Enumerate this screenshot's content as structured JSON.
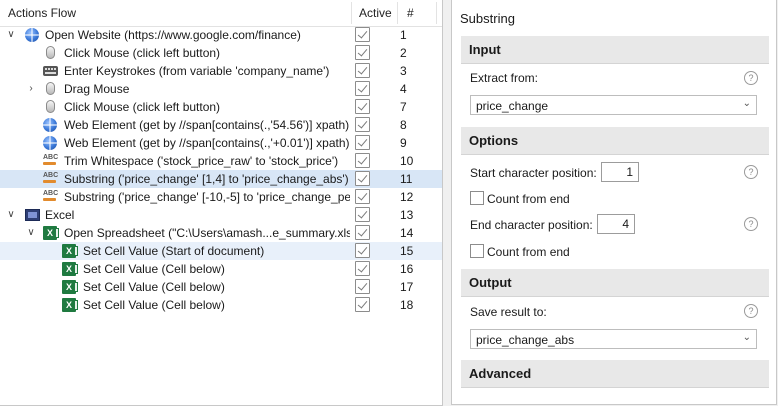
{
  "left_panel": {
    "col_actions": "Actions Flow",
    "col_active": "Active",
    "col_num": "#",
    "rows": [
      {
        "label": "Open Website (https://www.google.com/finance)",
        "num": "1"
      },
      {
        "label": "Click Mouse (click left button)",
        "num": "2"
      },
      {
        "label": "Enter Keystrokes (from variable 'company_name')",
        "num": "3"
      },
      {
        "label": "Drag Mouse",
        "num": "4"
      },
      {
        "label": "Click Mouse (click left button)",
        "num": "7"
      },
      {
        "label": "Web Element (get by //span[contains(.,'54.56')] xpath)",
        "num": "8"
      },
      {
        "label": "Web Element (get by //span[contains(.,'+0.01')] xpath)",
        "num": "9"
      },
      {
        "label": "Trim Whitespace ('stock_price_raw' to 'stock_price')",
        "num": "10"
      },
      {
        "label": "Substring ('price_change' [1,4] to 'price_change_abs')",
        "num": "11"
      },
      {
        "label": "Substring ('price_change' [-10,-5] to 'price_change_per",
        "num": "12"
      },
      {
        "label": "Excel",
        "num": "13"
      },
      {
        "label": "Open Spreadsheet (\"C:\\Users\\amash...e_summary.xlsx\"",
        "num": "14"
      },
      {
        "label": "Set Cell Value (Start of document)",
        "num": "15"
      },
      {
        "label": "Set Cell Value (Cell below)",
        "num": "16"
      },
      {
        "label": "Set Cell Value (Cell below)",
        "num": "17"
      },
      {
        "label": "Set Cell Value (Cell below)",
        "num": "18"
      }
    ]
  },
  "right_panel": {
    "title": "Substring",
    "input_header": "Input",
    "extract_from_label": "Extract from:",
    "extract_from_value": "price_change",
    "options_header": "Options",
    "start_pos_label": "Start character position:",
    "start_pos_value": "1",
    "count_from_end_1": "Count from end",
    "end_pos_label": "End character position:",
    "end_pos_value": "4",
    "count_from_end_2": "Count from end",
    "output_header": "Output",
    "save_result_label": "Save result to:",
    "save_result_value": "price_change_abs",
    "advanced_header": "Advanced",
    "help_glyph": "?",
    "dropdown_glyph": "⌄"
  },
  "colors": {
    "selected_row": "#d8e6f6",
    "section_bg": "#e8e8e8"
  }
}
